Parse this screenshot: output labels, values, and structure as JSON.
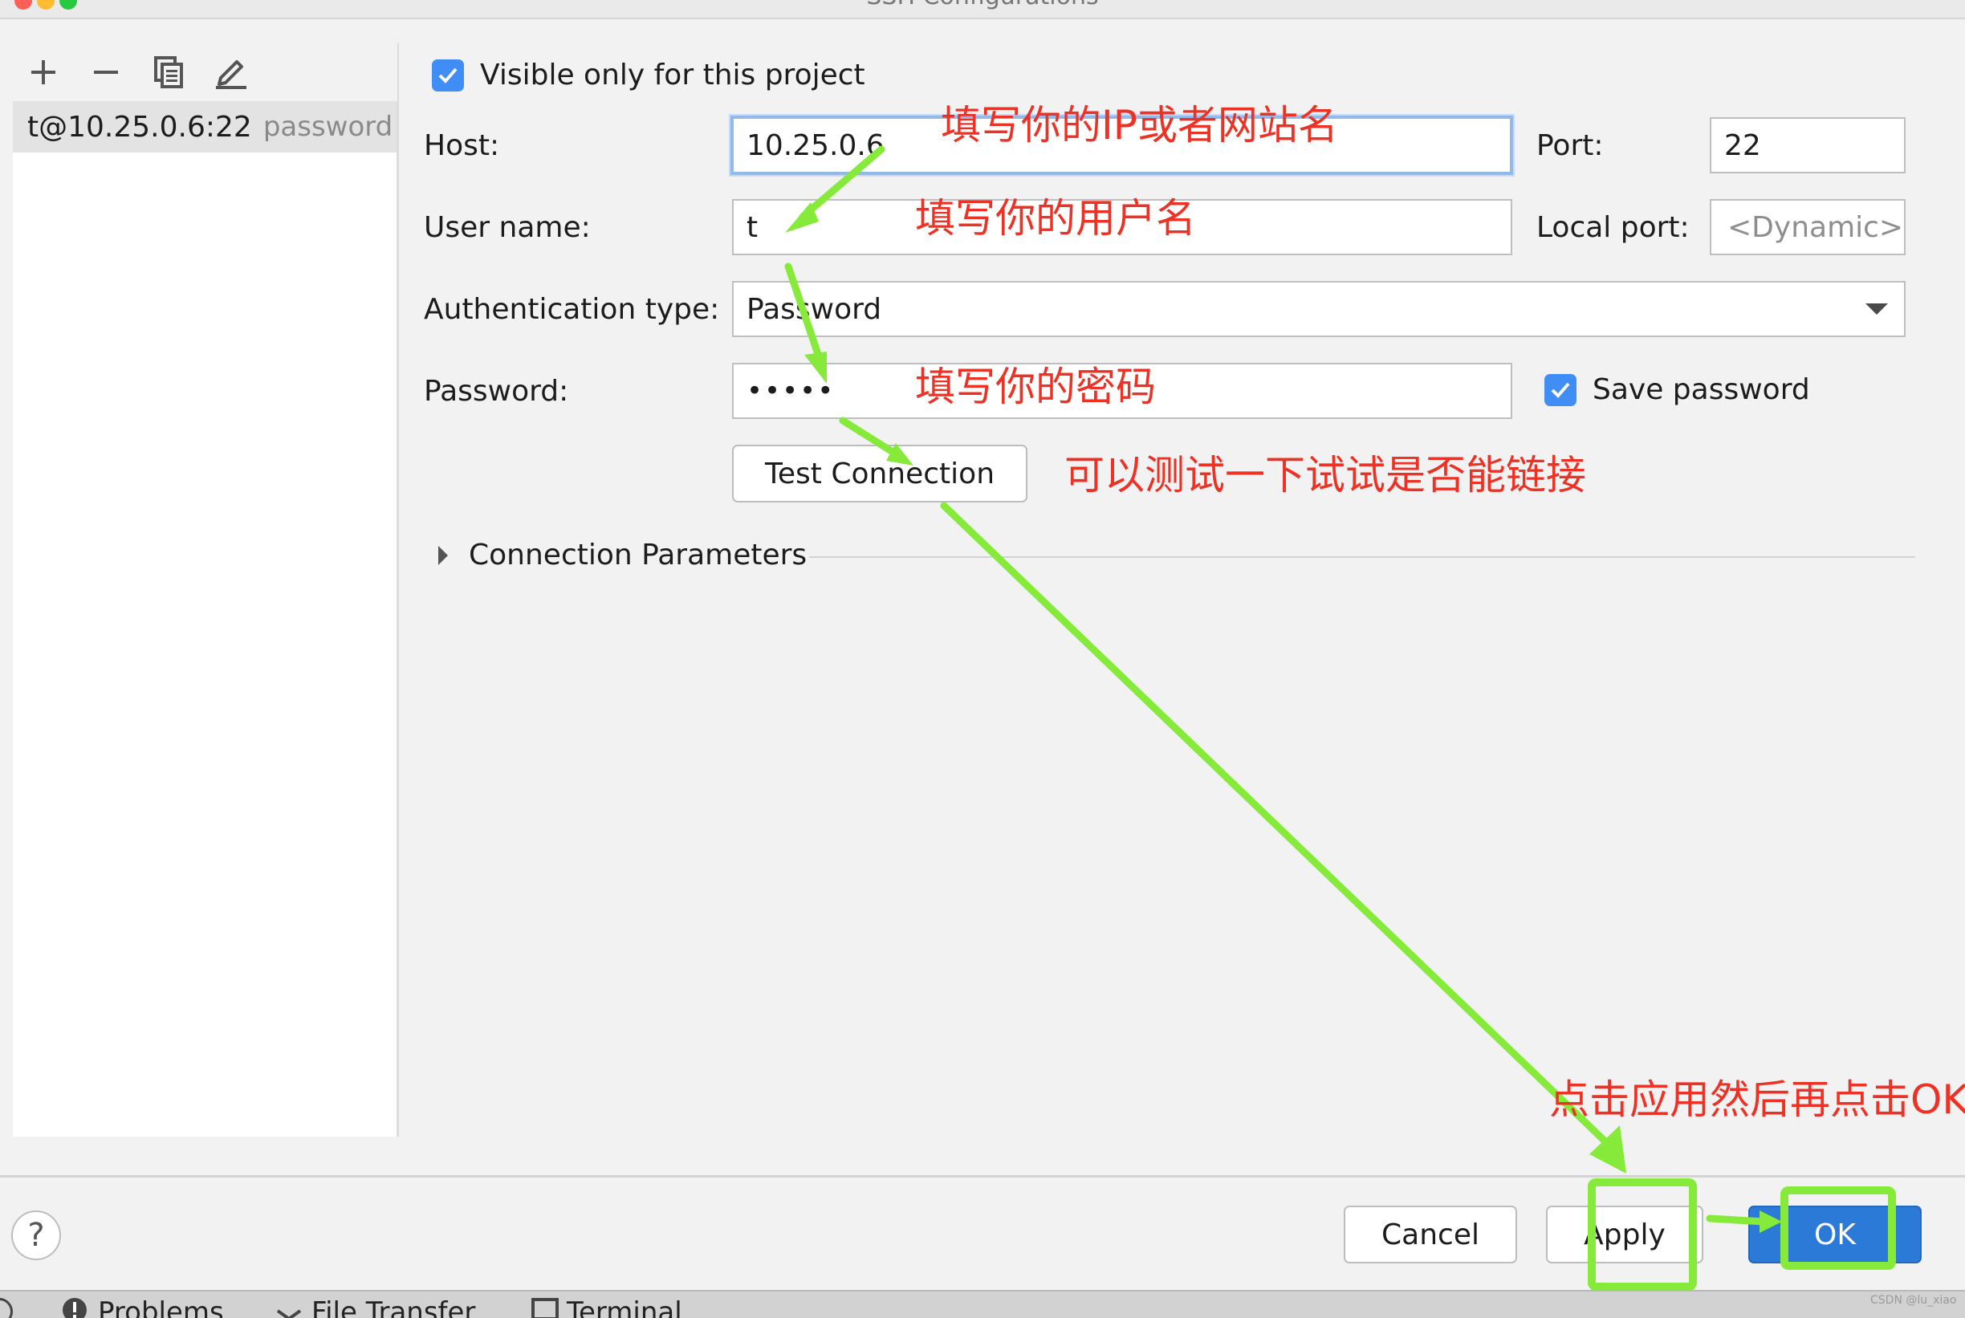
{
  "window": {
    "title": "SSH Configurations"
  },
  "toolbar": {
    "add_icon": "plus-icon",
    "remove_icon": "minus-icon",
    "copy_icon": "copy-icon",
    "edit_icon": "pencil-icon"
  },
  "connections": [
    {
      "name": "t@10.25.0.6:22",
      "auth": "password"
    }
  ],
  "form": {
    "visible_only": {
      "label": "Visible only for this project",
      "checked": true
    },
    "host": {
      "label": "Host:",
      "value": "10.25.0.6"
    },
    "port": {
      "label": "Port:",
      "value": "22"
    },
    "username": {
      "label": "User name:",
      "value": "t"
    },
    "local_port": {
      "label": "Local port:",
      "placeholder": "<Dynamic>"
    },
    "auth_type": {
      "label": "Authentication type:",
      "value": "Password"
    },
    "password": {
      "label": "Password:",
      "value": "•••••"
    },
    "save_password": {
      "label": "Save password",
      "checked": true
    },
    "test_connection": "Test Connection",
    "connection_parameters": "Connection Parameters"
  },
  "footer": {
    "help": "?",
    "cancel": "Cancel",
    "apply": "Apply",
    "ok": "OK"
  },
  "statusbar": {
    "items": [
      "Problems",
      "File Transfer",
      "Terminal"
    ]
  },
  "annotations": {
    "host_note": "填写你的IP或者网站名",
    "user_note": "填写你的用户名",
    "password_note": "填写你的密码",
    "test_note": "可以测试一下试试是否能链接",
    "apply_note": "点击应用然后再点击OK"
  },
  "watermark": "CSDN @lu_xiao",
  "colors": {
    "accent": "#3f8df5",
    "annotation_text": "#ee3125",
    "annotation_arrow": "#86ea3a",
    "ok_button": "#2c7ad8"
  }
}
